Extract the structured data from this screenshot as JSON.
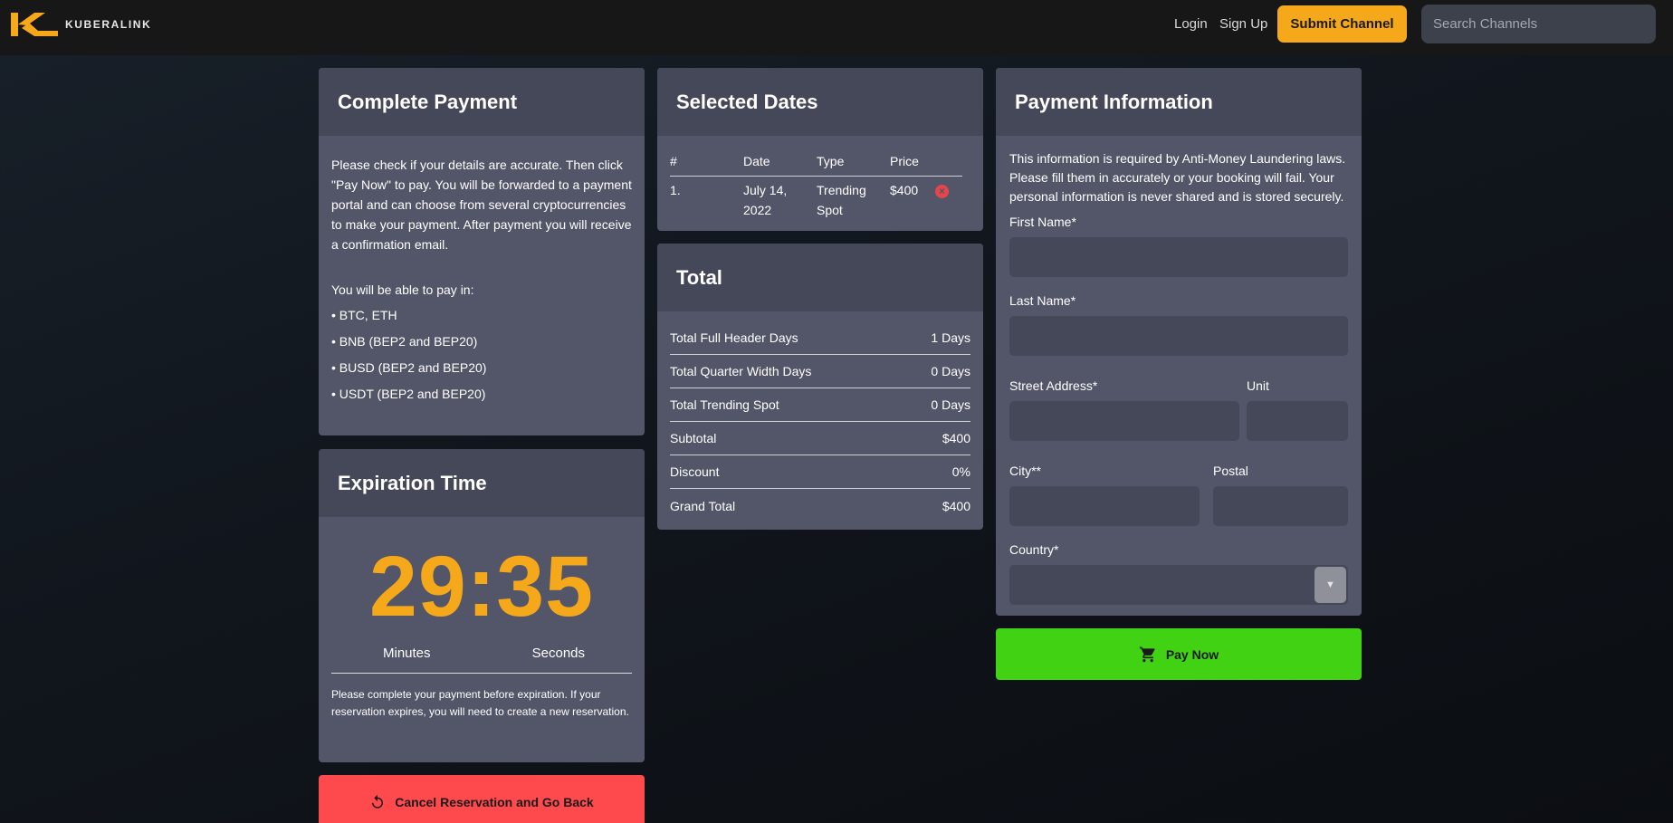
{
  "header": {
    "brand": "KUBERALINK",
    "login": "Login",
    "signup": "Sign Up",
    "submit_channel": "Submit Channel",
    "search_placeholder": "Search Channels"
  },
  "complete_payment": {
    "title": "Complete Payment",
    "intro": "Please check if your details are accurate. Then click \"Pay Now\" to pay. You will be forwarded to a payment portal and can choose from several cryptocurrencies to make your payment. After payment you will receive a confirmation email.",
    "pay_in": "You will be able to pay in:",
    "currencies": [
      "• BTC, ETH",
      "• BNB (BEP2 and BEP20)",
      "• BUSD (BEP2 and BEP20)",
      "• USDT (BEP2 and BEP20)"
    ]
  },
  "expiration": {
    "title": "Expiration Time",
    "timer": "29:35",
    "minutes_label": "Minutes",
    "seconds_label": "Seconds",
    "note": "Please complete your payment before expiration. If your reservation expires, you will need to create a new reservation."
  },
  "cancel_button": "Cancel Reservation and Go Back",
  "selected_dates": {
    "title": "Selected Dates",
    "columns": [
      "#",
      "Date",
      "Type",
      "Price"
    ],
    "rows": [
      {
        "num": "1.",
        "date": "July 14, 2022",
        "type": "Trending Spot",
        "price": "$400"
      }
    ]
  },
  "total": {
    "title": "Total",
    "rows": [
      {
        "label": "Total Full Header Days",
        "value": "1 Days"
      },
      {
        "label": "Total Quarter Width Days",
        "value": "0 Days"
      },
      {
        "label": "Total Trending Spot",
        "value": "0 Days"
      },
      {
        "label": "Subtotal",
        "value": "$400"
      },
      {
        "label": "Discount",
        "value": "0%"
      },
      {
        "label": "Grand Total",
        "value": "$400"
      }
    ]
  },
  "payment_info": {
    "title": "Payment Information",
    "intro": "This information is required by Anti-Money Laundering laws. Please fill them in accurately or your booking will fail. Your personal information is never shared and is stored securely.",
    "first_name": "First Name*",
    "last_name": "Last Name*",
    "street": "Street Address*",
    "unit": "Unit",
    "city": "City**",
    "postal": "Postal",
    "country": "Country*"
  },
  "pay_button": "Pay Now",
  "colors": {
    "accent": "#f6a81b",
    "pay": "#41d214",
    "cancel": "#ff4a4d",
    "card": "#525668",
    "card_header": "#454859"
  }
}
